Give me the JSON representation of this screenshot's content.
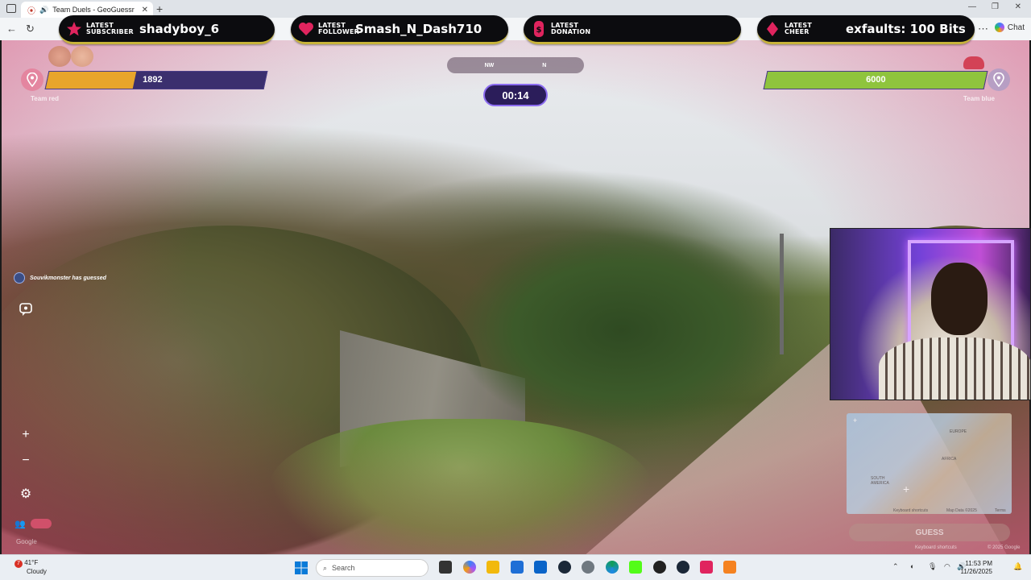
{
  "browser": {
    "tab_title": "Team Duels - GeoGuessr",
    "chat_label": "Chat"
  },
  "alerts": [
    {
      "label_line1": "LATEST",
      "label_line2": "SUBSCRIBER",
      "value": "shadyboy_6",
      "icon": "star-icon",
      "color": "#e0245e"
    },
    {
      "label_line1": "LATEST",
      "label_line2": "FOLLOWER",
      "value": "Smash_N_Dash710",
      "icon": "heart-icon",
      "color": "#e0245e"
    },
    {
      "label_line1": "LATEST",
      "label_line2": "DONATION",
      "value": "",
      "icon": "dollar-icon",
      "color": "#e0245e"
    },
    {
      "label_line1": "LATEST",
      "label_line2": "CHEER",
      "value": "exfaults: 100 Bits",
      "icon": "diamond-icon",
      "color": "#e0245e"
    }
  ],
  "game": {
    "team_red": {
      "label": "Team red",
      "health": 1892,
      "health_fraction": 0.4,
      "color": "#e8a52b"
    },
    "team_blue": {
      "label": "Team blue",
      "health": 6000,
      "health_fraction": 1.0,
      "color": "#8fc43d"
    },
    "compass": {
      "heading": "NW",
      "marker": "N"
    },
    "timer": "00:14",
    "guess_notice": "Souvikmonster has guessed",
    "guess_button": "GUESS",
    "minimap_labels": {
      "europe": "EUROPE",
      "africa": "AFRICA",
      "south_america": "SOUTH AMERICA",
      "shortcuts": "Keyboard shortcuts",
      "map_data": "Map Data ©2025",
      "terms": "Terms"
    },
    "google": "Google",
    "footer_keyboard": "Keyboard shortcuts",
    "footer_copyright": "© 2025 Google"
  },
  "taskbar": {
    "temperature": "41°F",
    "condition": "Cloudy",
    "weather_badge": "7",
    "search_placeholder": "Search",
    "time": "11:53 PM",
    "date": "11/26/2025"
  }
}
